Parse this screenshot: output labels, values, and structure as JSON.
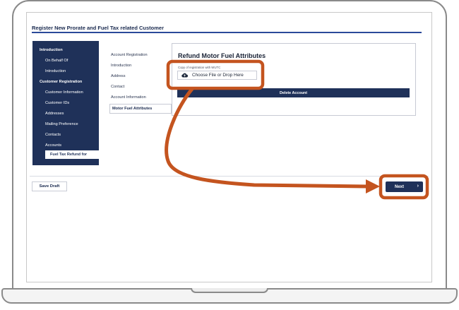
{
  "page_title": "Register New Prorate and Fuel Tax related Customer",
  "sidebar": {
    "items": [
      {
        "label": "Introduction",
        "kind": "section"
      },
      {
        "label": "On Behalf Of",
        "kind": "sub"
      },
      {
        "label": "Introduction",
        "kind": "sub"
      },
      {
        "label": "Customer Registration",
        "kind": "section"
      },
      {
        "label": "Customer Information",
        "kind": "sub"
      },
      {
        "label": "Customer IDs",
        "kind": "sub"
      },
      {
        "label": "Addresses",
        "kind": "sub"
      },
      {
        "label": "Mailing Preference",
        "kind": "sub"
      },
      {
        "label": "Contacts",
        "kind": "sub"
      },
      {
        "label": "Accounts",
        "kind": "sub"
      },
      {
        "label": "Fuel Tax Refund for",
        "kind": "active"
      }
    ]
  },
  "steps": [
    {
      "label": "Account Registration"
    },
    {
      "label": "Introduction"
    },
    {
      "label": "Address"
    },
    {
      "label": "Contact"
    },
    {
      "label": "Account Information"
    },
    {
      "label": "Motor Fuel Attributes",
      "active": true
    }
  ],
  "panel": {
    "title": "Refund Motor Fuel Attributes",
    "upload_label": "Copy of registration with WUTC",
    "upload_button": "Choose File or Drop Here",
    "upload_icon": "cloud-upload-icon",
    "delete_button": "Delete Account"
  },
  "footer": {
    "save_draft": "Save Draft",
    "next": "Next",
    "next_icon": "chevron-right-icon"
  },
  "colors": {
    "navy": "#1f3159",
    "highlight": "#c4541f"
  }
}
